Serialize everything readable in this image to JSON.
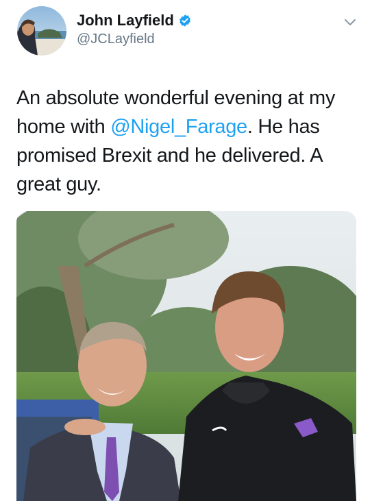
{
  "tweet": {
    "author": {
      "display_name": "John Layfield",
      "handle": "@JCLayfield",
      "verified": true
    },
    "text_before": "An absolute wonderful evening at my home with ",
    "mention": "@Nigel_Farage",
    "text_after": ". He has promised Brexit and he delivered. A great guy.",
    "icons": {
      "verified": "verified-badge-icon",
      "menu": "chevron-down-icon"
    },
    "colors": {
      "link": "#1da1f2",
      "handle": "#657786",
      "verified": "#1da1f2"
    }
  }
}
